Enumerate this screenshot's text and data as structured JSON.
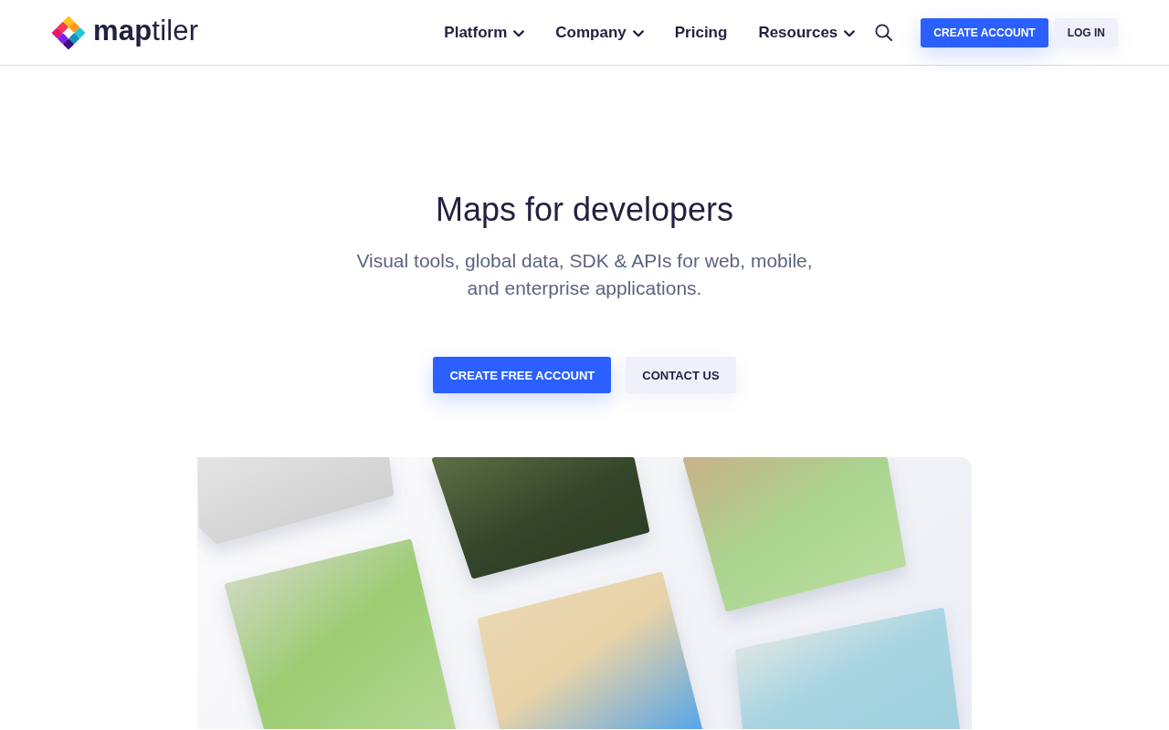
{
  "header": {
    "logo": {
      "wordmark": "**map**tiler"
    },
    "nav": [
      {
        "label": "Platform",
        "kind": "dropdown"
      },
      {
        "label": "Company",
        "kind": "dropdown"
      },
      {
        "label": "Pricing",
        "kind": "link"
      },
      {
        "label": "Resources",
        "kind": "dropdown"
      }
    ],
    "buttons": [
      {
        "label": "CREATE ACCOUNT",
        "kind": "primary"
      },
      {
        "label": "LOG IN",
        "kind": "secondary"
      }
    ]
  },
  "hero": {
    "title": "Maps for developers",
    "subtitle": "Visual tools, global data, SDK & APIs for web, mobile, and enterprise applications.",
    "buttons": [
      {
        "label": "CREATE FREE ACCOUNT",
        "kind": "primary"
      },
      {
        "label": "CONTACT US",
        "kind": "secondary"
      }
    ]
  }
}
